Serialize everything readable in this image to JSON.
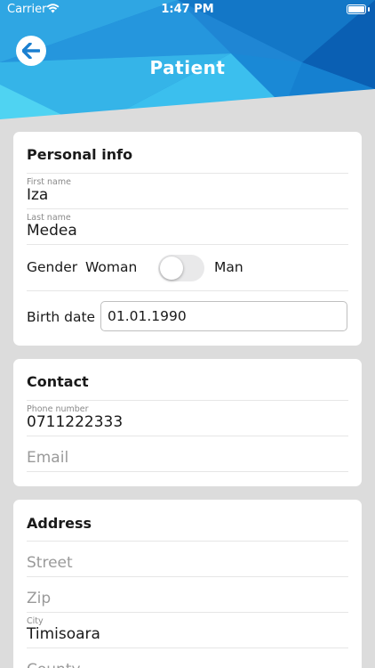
{
  "status": {
    "carrier": "Carrier",
    "time": "1:47 PM"
  },
  "header": {
    "title": "Patient"
  },
  "personal": {
    "title": "Personal info",
    "first_name_label": "First name",
    "first_name": "Iza",
    "last_name_label": "Last name",
    "last_name": "Medea",
    "gender_label": "Gender",
    "woman_label": "Woman",
    "man_label": "Man",
    "birth_label": "Birth date",
    "birth_value": "01.01.1990"
  },
  "contact": {
    "title": "Contact",
    "phone_label": "Phone number",
    "phone": "0711222333",
    "email_placeholder": "Email"
  },
  "address": {
    "title": "Address",
    "street_placeholder": "Street",
    "zip_placeholder": "Zip",
    "city_label": "City",
    "city": "Timisoara",
    "county_placeholder": "County"
  },
  "colors": {
    "header_blue": "#1a7fd0",
    "background": "#dcdcdc"
  }
}
